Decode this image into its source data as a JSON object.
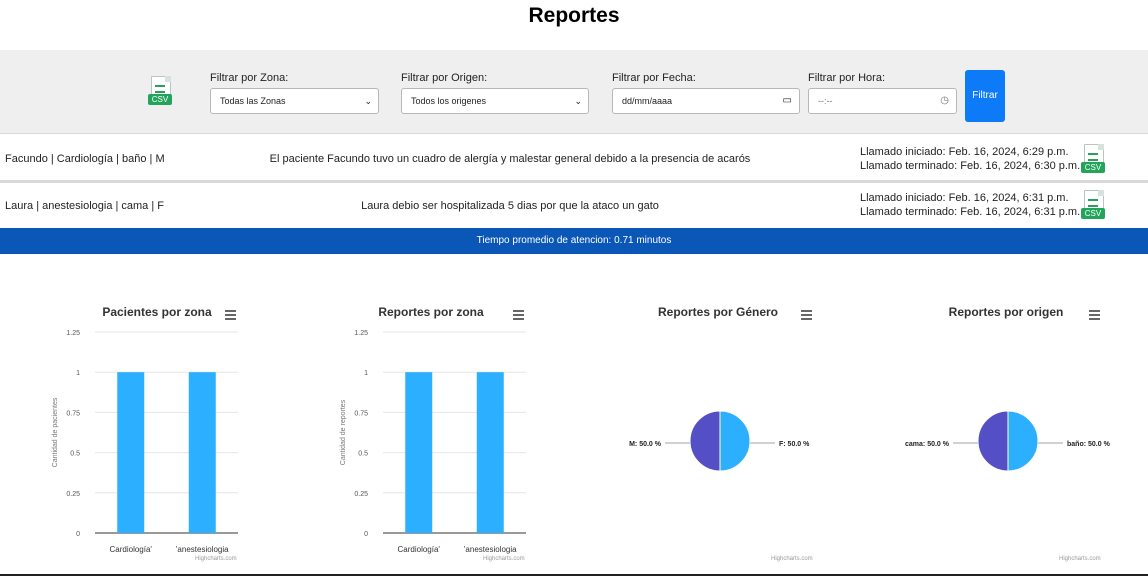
{
  "page": {
    "title": "Reportes"
  },
  "filters": {
    "csv_icon_label": "CSV",
    "zona": {
      "label": "Filtrar por Zona:",
      "value": "Todas las Zonas"
    },
    "origen": {
      "label": "Filtrar por Origen:",
      "value": "Todos los origenes"
    },
    "fecha": {
      "label": "Filtrar por Fecha:",
      "value": "dd/mm/aaaa"
    },
    "hora": {
      "label": "Filtrar por Hora:",
      "value": "--:--"
    },
    "button": "Filtrar",
    "icons": {
      "select": "chevron-down-icon",
      "date": "calendar-icon",
      "time": "clock-icon",
      "csv": "csv-file-icon"
    }
  },
  "reports": [
    {
      "who": "Facundo | Cardiología | baño | M",
      "message": "El paciente Facundo tuvo un cuadro de alergía y malestar general debido a la presencia de acarós",
      "started": "Llamado iniciado: Feb. 16, 2024, 6:29 p.m.",
      "ended": "Llamado terminado: Feb. 16, 2024, 6:30 p.m.",
      "csv": "CSV"
    },
    {
      "who": "Laura | anestesiologia | cama | F",
      "message": "Laura debio ser hospitalizada 5 dias por que la ataco un gato",
      "started": "Llamado iniciado: Feb. 16, 2024, 6:31 p.m.",
      "ended": "Llamado terminado: Feb. 16, 2024, 6:31 p.m.",
      "csv": "CSV"
    }
  ],
  "summary": {
    "average": "Tiempo promedio de atencion: 0.71 minutos"
  },
  "credit": "Highcharts.com",
  "colors": {
    "bar": "#2caffe",
    "pie_a": "#544fc5",
    "pie_b": "#2caffe",
    "average_bar": "#0b57b7",
    "button": "#0d7bf7"
  },
  "chart_data": [
    {
      "type": "bar",
      "title": "Pacientes por zona",
      "ylabel": "Cantidad de pacientes",
      "categories": [
        "Cardiología'",
        "'anestesiologia"
      ],
      "values": [
        1,
        1
      ],
      "ylim": [
        0,
        1.25
      ],
      "yticks": [
        "0",
        "0.25",
        "0.5",
        "0.75",
        "1",
        "1.25"
      ],
      "grid": true
    },
    {
      "type": "bar",
      "title": "Reportes por zona",
      "ylabel": "Cantidad de reportes",
      "categories": [
        "Cardiología'",
        "'anestesiologia"
      ],
      "values": [
        1,
        1
      ],
      "ylim": [
        0,
        1.25
      ],
      "yticks": [
        "0",
        "0.25",
        "0.5",
        "0.75",
        "1",
        "1.25"
      ],
      "grid": true
    },
    {
      "type": "pie",
      "title": "Reportes por Género",
      "slices": [
        {
          "label": "M: 50.0 %",
          "value": 50.0
        },
        {
          "label": "F: 50.0 %",
          "value": 50.0
        }
      ]
    },
    {
      "type": "pie",
      "title": "Reportes por origen",
      "slices": [
        {
          "label": "cama: 50.0 %",
          "value": 50.0
        },
        {
          "label": "baño: 50.0 %",
          "value": 50.0
        }
      ]
    }
  ]
}
